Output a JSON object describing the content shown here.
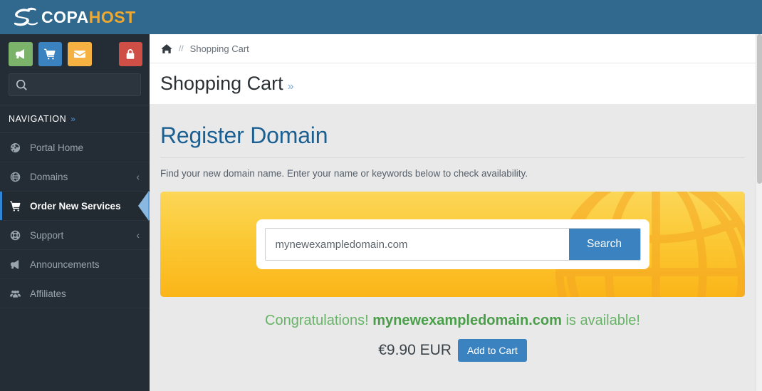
{
  "brand": {
    "name_primary": "COPA",
    "name_secondary": "HOST",
    "logo_icon": "swirl-logo-icon",
    "bar_color": "#31688e"
  },
  "sidebar": {
    "quick_buttons": [
      {
        "name": "announcements-button",
        "icon": "megaphone-icon",
        "color": "#7cb36a"
      },
      {
        "name": "cart-button",
        "icon": "shopping-cart-icon",
        "color": "#3b83c0"
      },
      {
        "name": "mail-button",
        "icon": "envelope-icon",
        "color": "#f5b243"
      },
      {
        "name": "logout-button",
        "icon": "lock-icon",
        "color": "#cf4f46"
      }
    ],
    "search": {
      "value": "",
      "placeholder": "",
      "icon": "search-icon"
    },
    "nav_header": {
      "label": "NAVIGATION",
      "chevron": "»"
    },
    "items": [
      {
        "label": "Portal Home",
        "icon": "dashboard-icon",
        "chevron": "",
        "active": false
      },
      {
        "label": "Domains",
        "icon": "globe-icon",
        "chevron": "‹",
        "active": false
      },
      {
        "label": "Order New Services",
        "icon": "cart-icon",
        "chevron": "",
        "active": true
      },
      {
        "label": "Support",
        "icon": "lifebuoy-icon",
        "chevron": "‹",
        "active": false
      },
      {
        "label": "Announcements",
        "icon": "megaphone-icon",
        "chevron": "",
        "active": false
      },
      {
        "label": "Affiliates",
        "icon": "users-icon",
        "chevron": "",
        "active": false
      }
    ]
  },
  "breadcrumb": {
    "home_icon": "home-icon",
    "separator": "//",
    "current": "Shopping Cart"
  },
  "page": {
    "title": "Shopping Cart",
    "title_chevron": "»"
  },
  "register": {
    "heading": "Register Domain",
    "subtitle": "Find your new domain name. Enter your name or keywords below to check availability.",
    "banner": {
      "background_icon": "globe-wireframe-icon",
      "gradient_from": "#fcd657",
      "gradient_to": "#fbb518"
    },
    "search": {
      "value": "mynewexampledomain.com",
      "placeholder": "",
      "button_label": "Search",
      "button_color": "#3b83c0"
    },
    "result": {
      "prefix": "Congratulations!",
      "domain": "mynewexampledomain.com",
      "suffix": "is available!",
      "color": "#68b368"
    },
    "price": "€9.90 EUR",
    "add_to_cart_label": "Add to Cart"
  }
}
